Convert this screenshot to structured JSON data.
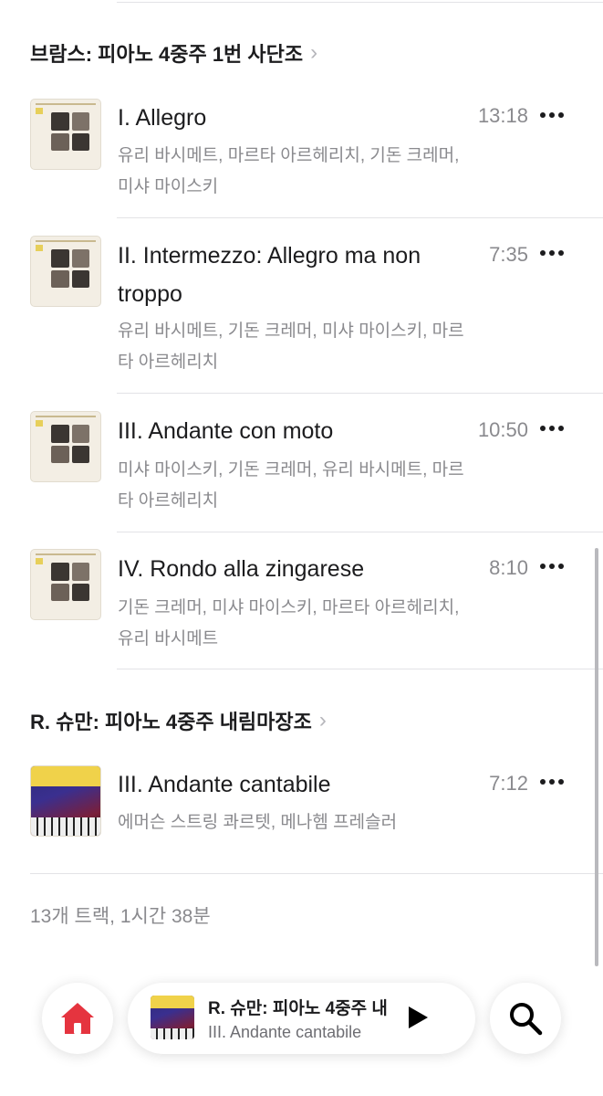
{
  "sections": [
    {
      "header": "브람스: 피아노 4중주 1번 사단조",
      "tracks": [
        {
          "title": "I. Allegro",
          "duration": "13:18",
          "artists": "유리 바시메트, 마르타 아르헤리치, 기돈 크레머, 미샤 마이스키"
        },
        {
          "title": "II. Intermezzo: Allegro ma non troppo",
          "duration": "7:35",
          "artists": "유리 바시메트, 기돈 크레머, 미샤 마이스키, 마르타 아르헤리치"
        },
        {
          "title": "III. Andante con moto",
          "duration": "10:50",
          "artists": "미샤 마이스키, 기돈 크레머, 유리 바시메트, 마르타 아르헤리치"
        },
        {
          "title": "IV. Rondo alla zingarese",
          "duration": "8:10",
          "artists": "기돈 크레머, 미샤 마이스키, 마르타 아르헤리치, 유리 바시메트"
        }
      ]
    },
    {
      "header": "R. 슈만: 피아노 4중주 내림마장조",
      "tracks": [
        {
          "title": "III. Andante cantabile",
          "duration": "7:12",
          "artists": "에머슨 스트링 콰르텟, 메나헴 프레슬러"
        }
      ]
    }
  ],
  "summary": "13개 트랙, 1시간 38분",
  "mini_player": {
    "title": "R. 슈만: 피아노 4중주 내",
    "subtitle": "III. Andante cantabile"
  },
  "icons": {
    "home": "home-icon",
    "search": "search-icon",
    "play": "play-icon",
    "more": "more-icon",
    "chevron": "chevron-right-icon"
  },
  "colors": {
    "accent_home": "#e5343f",
    "secondary_text": "#8a8a8e"
  }
}
